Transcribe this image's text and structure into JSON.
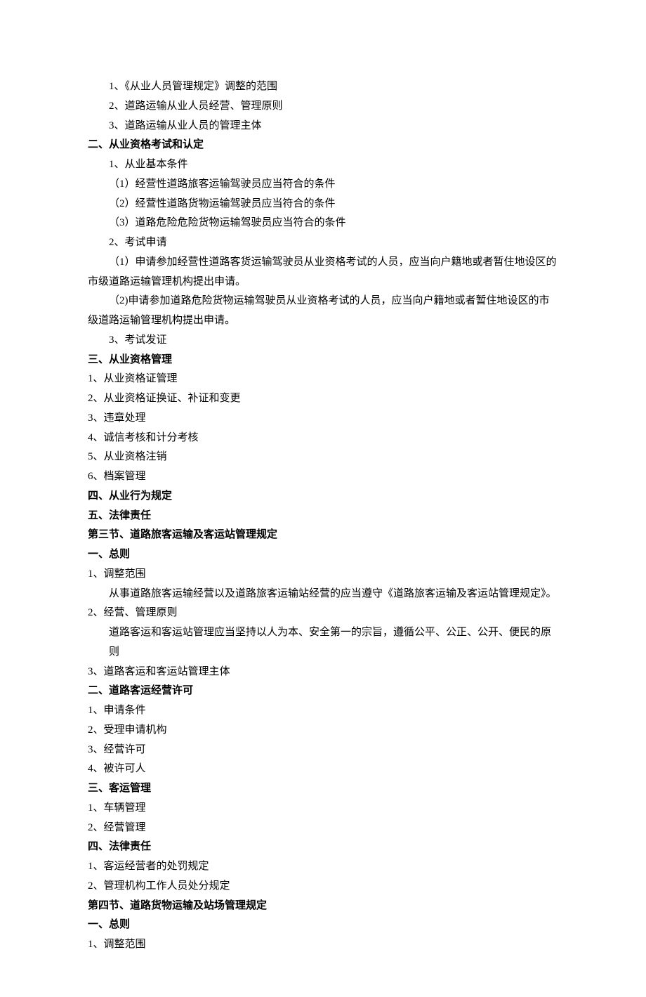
{
  "lines": [
    {
      "text": "1、《从业人员管理规定》调整的范围",
      "indent": 2,
      "bold": false
    },
    {
      "text": "2、道路运输从业人员经营、管理原则",
      "indent": 2,
      "bold": false
    },
    {
      "text": "3、道路运输从业人员的管理主体",
      "indent": 2,
      "bold": false
    },
    {
      "text": "二、从业资格考试和认定",
      "indent": 0,
      "bold": true
    },
    {
      "text": "1、从业基本条件",
      "indent": 2,
      "bold": false
    },
    {
      "text": "（1）经营性道路旅客运输驾驶员应当符合的条件",
      "indent": 2,
      "bold": false
    },
    {
      "text": "（2）经营性道路货物运输驾驶员应当符合的条件",
      "indent": 2,
      "bold": false
    },
    {
      "text": "（3）道路危险危险货物运输驾驶员应当符合的条件",
      "indent": 2,
      "bold": false
    },
    {
      "text": "2、考试申请",
      "indent": 2,
      "bold": false
    },
    {
      "text": "（1）申请参加经营性道路客货运输驾驶员从业资格考试的人员，应当向户籍地或者暂住地设区的市级道路运输管理机构提出申请。",
      "indent": 2,
      "bold": false,
      "para": true
    },
    {
      "text": "（2)申请参加道路危险货物运输驾驶员从业资格考试的人员，应当向户籍地或者暂住地设区的市级道路运输管理机构提出申请。",
      "indent": 2,
      "bold": false,
      "para": true
    },
    {
      "text": "3、考试发证",
      "indent": 2,
      "bold": false
    },
    {
      "text": "三、从业资格管理",
      "indent": 0,
      "bold": true
    },
    {
      "text": "1、从业资格证管理",
      "indent": 0,
      "bold": false
    },
    {
      "text": "2、从业资格证换证、补证和变更",
      "indent": 0,
      "bold": false
    },
    {
      "text": "3、违章处理",
      "indent": 0,
      "bold": false
    },
    {
      "text": "4、诚信考核和计分考核",
      "indent": 0,
      "bold": false
    },
    {
      "text": "5、从业资格注销",
      "indent": 0,
      "bold": false
    },
    {
      "text": "6、档案管理",
      "indent": 0,
      "bold": false
    },
    {
      "text": "四、从业行为规定",
      "indent": 0,
      "bold": true
    },
    {
      "text": "五、法律责任",
      "indent": 0,
      "bold": true
    },
    {
      "text": "第三节、道路旅客运输及客运站管理规定",
      "indent": 0,
      "bold": true
    },
    {
      "text": "一、总则",
      "indent": 0,
      "bold": true
    },
    {
      "text": "1、调整范围",
      "indent": 0,
      "bold": false
    },
    {
      "text": "从事道路旅客运输经营以及道路旅客运输站经营的应当遵守《道路旅客运输及客运站管理规定》。",
      "indent": 2,
      "bold": false
    },
    {
      "text": "2、经营、管理原则",
      "indent": 0,
      "bold": false
    },
    {
      "text": "道路客运和客运站管理应当坚持以人为本、安全第一的宗旨，遵循公平、公正、公开、便民的原则",
      "indent": 2,
      "bold": false
    },
    {
      "text": "3、道路客运和客运站管理主体",
      "indent": 0,
      "bold": false
    },
    {
      "text": "二、道路客运经营许可",
      "indent": 0,
      "bold": true
    },
    {
      "text": "1、申请条件",
      "indent": 0,
      "bold": false
    },
    {
      "text": "2、受理申请机构",
      "indent": 0,
      "bold": false
    },
    {
      "text": "3、经营许可",
      "indent": 0,
      "bold": false
    },
    {
      "text": "4、被许可人",
      "indent": 0,
      "bold": false
    },
    {
      "text": "三、客运管理",
      "indent": 0,
      "bold": true
    },
    {
      "text": "1、车辆管理",
      "indent": 0,
      "bold": false
    },
    {
      "text": "2、经营管理",
      "indent": 0,
      "bold": false
    },
    {
      "text": "四、法律责任",
      "indent": 0,
      "bold": true
    },
    {
      "text": "1、客运经营者的处罚规定",
      "indent": 0,
      "bold": false
    },
    {
      "text": "2、管理机构工作人员处分规定",
      "indent": 0,
      "bold": false
    },
    {
      "text": "第四节、道路货物运输及站场管理规定",
      "indent": 0,
      "bold": true
    },
    {
      "text": "一、总则",
      "indent": 0,
      "bold": true
    },
    {
      "text": "1、调整范围",
      "indent": 0,
      "bold": false
    }
  ]
}
